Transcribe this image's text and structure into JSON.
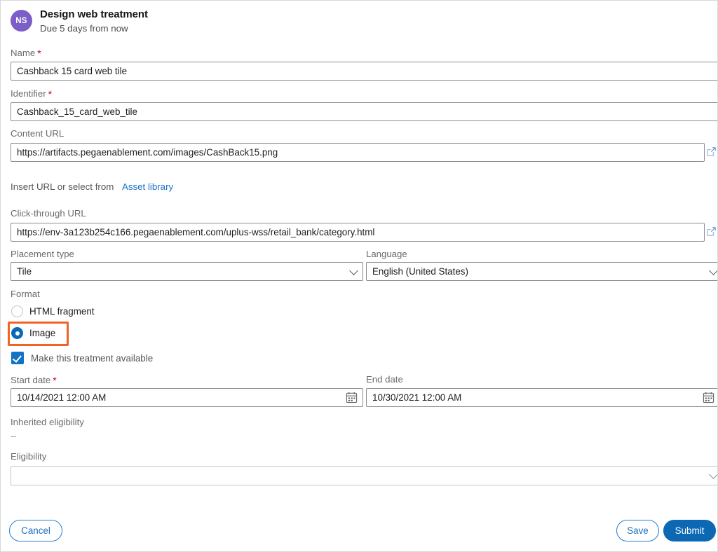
{
  "header": {
    "avatar_initials": "NS",
    "title": "Design web treatment",
    "subtitle": "Due 5 days from now"
  },
  "form": {
    "name": {
      "label": "Name",
      "required": true,
      "value": "Cashback 15 card web tile",
      "placeholder": ""
    },
    "identifier": {
      "label": "Identifier",
      "required": true,
      "value": "Cashback_15_card_web_tile",
      "placeholder": ""
    },
    "content_url": {
      "label": "Content URL",
      "required": false,
      "value": "https://artifacts.pegaenablement.com/images/CashBack15.png",
      "placeholder": "",
      "open_icon": "external-link-icon"
    },
    "asset_hint": {
      "text": "Insert URL or select from",
      "link_label": "Asset library"
    },
    "click_through_url": {
      "label": "Click-through URL",
      "required": false,
      "value": "https://env-3a123b254c166.pegaenablement.com/uplus-wss/retail_bank/category.html",
      "placeholder": "",
      "open_icon": "external-link-icon"
    },
    "placement_type": {
      "label": "Placement type",
      "value": "Tile",
      "options": [
        "Tile"
      ]
    },
    "language": {
      "label": "Language",
      "value": "English (United States)",
      "options": [
        "English (United States)"
      ]
    },
    "format": {
      "label": "Format",
      "options": [
        {
          "label": "HTML fragment",
          "selected": false
        },
        {
          "label": "Image",
          "selected": true
        }
      ],
      "highlight_color": "#ef6425",
      "highlighted_option": "Image"
    },
    "availability": {
      "label": "Make this treatment available",
      "checked": true
    },
    "start_date": {
      "label": "Start date",
      "required": true,
      "value": "10/14/2021 12:00 AM",
      "icon": "calendar-icon"
    },
    "end_date": {
      "label": "End date",
      "required": false,
      "value": "10/30/2021 12:00 AM",
      "icon": "calendar-icon"
    },
    "inherited_eligibility": {
      "label": "Inherited eligibility",
      "value": "--"
    },
    "eligibility": {
      "label": "Eligibility",
      "value": "",
      "options": []
    }
  },
  "footer": {
    "cancel_label": "Cancel",
    "save_label": "Save",
    "submit_label": "Submit",
    "primary_color": "#0d68b4"
  }
}
